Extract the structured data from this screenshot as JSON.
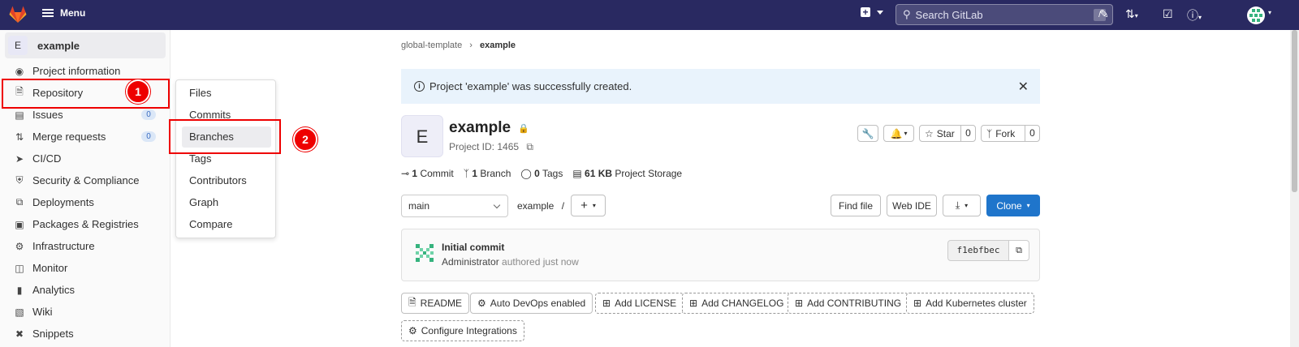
{
  "topbar": {
    "menu_label": "Menu",
    "search_placeholder": "Search GitLab",
    "search_shortcut": "/"
  },
  "sidebar": {
    "project_initial": "E",
    "project_name": "example",
    "items": [
      {
        "label": "Project information",
        "icon": "info-icon"
      },
      {
        "label": "Repository",
        "icon": "repository-icon"
      },
      {
        "label": "Issues",
        "icon": "issues-icon",
        "count": "0"
      },
      {
        "label": "Merge requests",
        "icon": "merge-request-icon",
        "count": "0"
      },
      {
        "label": "CI/CD",
        "icon": "rocket-icon"
      },
      {
        "label": "Security & Compliance",
        "icon": "shield-icon"
      },
      {
        "label": "Deployments",
        "icon": "deployments-icon"
      },
      {
        "label": "Packages & Registries",
        "icon": "package-icon"
      },
      {
        "label": "Infrastructure",
        "icon": "infrastructure-icon"
      },
      {
        "label": "Monitor",
        "icon": "monitor-icon"
      },
      {
        "label": "Analytics",
        "icon": "chart-icon"
      },
      {
        "label": "Wiki",
        "icon": "book-icon"
      },
      {
        "label": "Snippets",
        "icon": "snippet-icon"
      }
    ]
  },
  "flyout": {
    "items": [
      "Files",
      "Commits",
      "Branches",
      "Tags",
      "Contributors",
      "Graph",
      "Compare"
    ],
    "active": "Branches"
  },
  "annotations": {
    "marker1": "1",
    "marker2": "2",
    "color": "#ee0000"
  },
  "breadcrumb": {
    "parent": "global-template",
    "current": "example"
  },
  "alert": {
    "message": "Project 'example' was successfully created."
  },
  "project": {
    "initial": "E",
    "name": "example",
    "id_text": "Project ID: 1465",
    "star_label": "Star",
    "star_count": "0",
    "fork_label": "Fork",
    "fork_count": "0"
  },
  "stats": {
    "commits_num": "1",
    "commits_label": "Commit",
    "branches_num": "1",
    "branches_label": "Branch",
    "tags_num": "0",
    "tags_label": "Tags",
    "storage_num": "61 KB",
    "storage_label": "Project Storage"
  },
  "toolbar": {
    "branch": "main",
    "path": "example",
    "path_sep": "/",
    "find_file": "Find file",
    "web_ide": "Web IDE",
    "clone": "Clone"
  },
  "commit": {
    "title": "Initial commit",
    "author": "Administrator",
    "meta": "authored just now",
    "sha": "f1ebfbec"
  },
  "chips": {
    "readme": "README",
    "autodevops": "Auto DevOps enabled",
    "license": "Add LICENSE",
    "changelog": "Add CHANGELOG",
    "contributing": "Add CONTRIBUTING",
    "k8s": "Add Kubernetes cluster",
    "integrations": "Configure Integrations"
  },
  "colors": {
    "topbar": "#292961",
    "primary": "#1f75cb",
    "alert_bg": "#e9f3fc"
  }
}
